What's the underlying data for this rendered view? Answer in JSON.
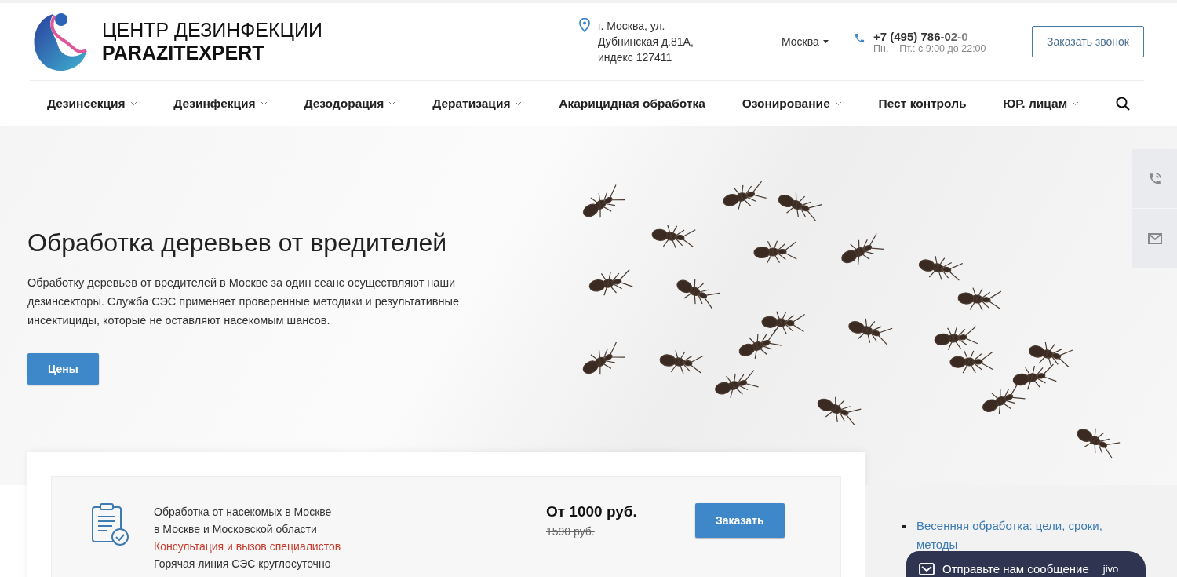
{
  "logo": {
    "line1": "ЦЕНТР ДЕЗИНФЕКЦИИ",
    "line2": "PARAZITEXPERT"
  },
  "address": [
    "г. Москва, ул.",
    "Дубнинская д.81А,",
    "индекс 127411"
  ],
  "city": "Москва",
  "phone": {
    "number": "+7 (495) 786-02-0",
    "hours": "Пн. – Пт.: с 9:00 до 22:00"
  },
  "callback_button": "Заказать звонок",
  "nav": [
    {
      "label": "Дезинсекция",
      "has_menu": true
    },
    {
      "label": "Дезинфекция",
      "has_menu": true
    },
    {
      "label": "Дезодорация",
      "has_menu": true
    },
    {
      "label": "Дератизация",
      "has_menu": true
    },
    {
      "label": "Акарицидная обработка",
      "has_menu": false
    },
    {
      "label": "Озонирование",
      "has_menu": true
    },
    {
      "label": "Пест контроль",
      "has_menu": false
    },
    {
      "label": "ЮР. лицам",
      "has_menu": true
    }
  ],
  "hero": {
    "title": "Обработка деревьев от вредителей",
    "text": "Обработку деревьев от вредителей в Москве за один сеанс осуществляют наши дезинсекторы. Служба СЭС применяет проверенные методики и результативные инсектициды, которые не оставляют насекомым шансов.",
    "button": "Цены"
  },
  "offer": {
    "lines": [
      {
        "text": "Обработка от насекомых в Москве",
        "kind": "plain"
      },
      {
        "text": "в Москве и Московской области",
        "kind": "plain"
      },
      {
        "text": "Консультация и вызов специалистов",
        "kind": "accent"
      },
      {
        "text": "Горячая линия СЭС круглосуточно",
        "kind": "plain"
      }
    ],
    "price": "От 1000 руб.",
    "old_price": "1590 руб.",
    "button": "Заказать"
  },
  "sidebar_links": [
    "Весенняя обработка: цели, сроки, методы"
  ],
  "chat": {
    "label": "Отправьте нам сообщение",
    "brand": "jivo"
  }
}
